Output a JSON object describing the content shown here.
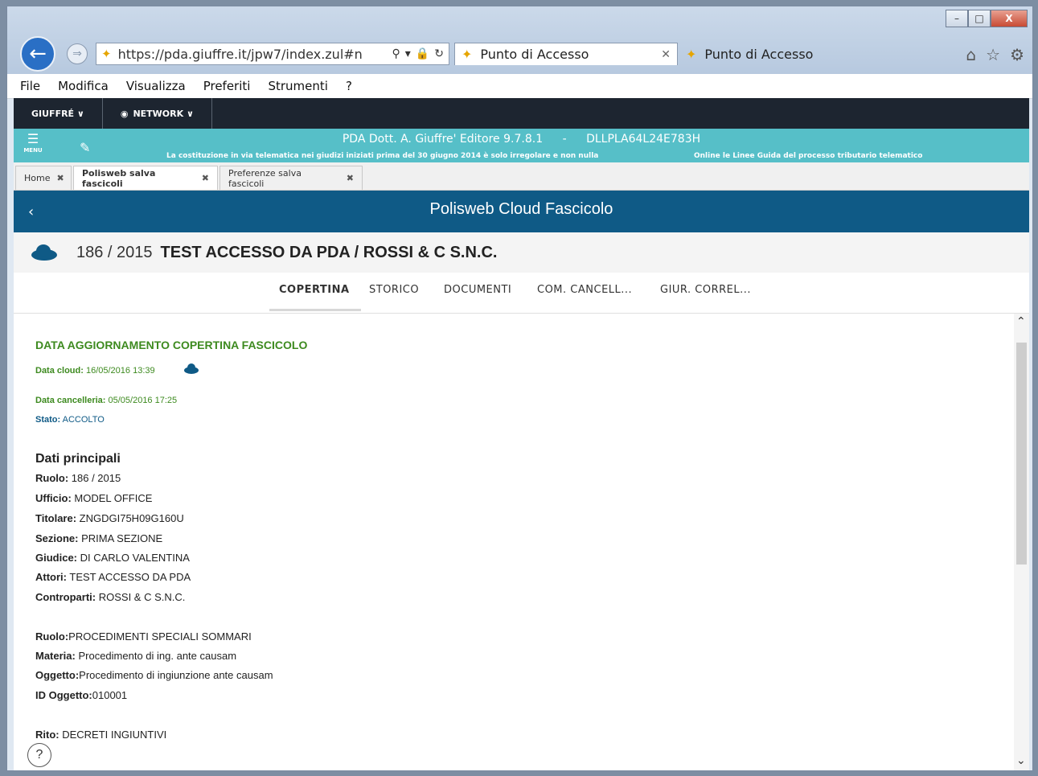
{
  "browser": {
    "url": "https://pda.giuffre.it/jpw7/index.zul#n",
    "tabs": [
      {
        "label": "Punto di Accesso",
        "active": true
      },
      {
        "label": "Punto di Accesso",
        "active": false
      }
    ],
    "menu": [
      "File",
      "Modifica",
      "Visualizza",
      "Preferiti",
      "Strumenti",
      "?"
    ],
    "window_buttons": {
      "min": "–",
      "max": "□",
      "close": "X"
    }
  },
  "navbar": {
    "items": [
      {
        "label": "GIUFFRÉ ∨",
        "icon": "chevron-down-icon"
      },
      {
        "label": "NETWORK ∨",
        "icon": "globe-icon"
      }
    ]
  },
  "banner": {
    "app": "PDA Dott. A. Giuffre' Editore 9.7.8.1",
    "separator": "-",
    "user_code": "DLLPLA64L24E783H",
    "notice_left": "La costituzione in via telematica nei giudizi iniziati prima del 30 giugno 2014 è solo irregolare e non nulla",
    "notice_right": "Online le Linee Guida del processo tributario telematico",
    "menu_label": "MENU"
  },
  "app_tabs": [
    {
      "label": "Home",
      "active": false
    },
    {
      "label": "Polisweb salva fascicoli",
      "active": true
    },
    {
      "label": "Preferenze salva fascicoli",
      "active": false
    }
  ],
  "header": {
    "title": "Polisweb Cloud Fascicolo"
  },
  "case": {
    "number": "186 / 2015",
    "name": "TEST ACCESSO DA PDA / ROSSI & C S.N.C."
  },
  "sections": [
    "COPERTINA",
    "STORICO",
    "DOCUMENTI",
    "COM. CANCELL...",
    "GIUR. CORREL..."
  ],
  "update": {
    "heading": "DATA AGGIORNAMENTO COPERTINA FASCICOLO",
    "cloud_label": "Data cloud:",
    "cloud_value": "16/05/2016 13:39",
    "registry_label": "Data cancelleria:",
    "registry_value": "05/05/2016 17:25",
    "status_label": "Stato:",
    "status_value": "ACCOLTO"
  },
  "main_data": {
    "title": "Dati principali",
    "fields": [
      {
        "label": "Ruolo:",
        "value": " 186 / 2015"
      },
      {
        "label": "Ufficio:",
        "value": " MODEL OFFICE"
      },
      {
        "label": "Titolare:",
        "value": " ZNGDGI75H09G160U"
      },
      {
        "label": "Sezione:",
        "value": " PRIMA SEZIONE"
      },
      {
        "label": "Giudice:",
        "value": " DI CARLO VALENTINA"
      },
      {
        "label": "Attori:",
        "value": " TEST ACCESSO DA PDA"
      },
      {
        "label": "Controparti:",
        "value": " ROSSI & C S.N.C."
      }
    ],
    "fields2": [
      {
        "label": "Ruolo:",
        "value": "PROCEDIMENTI SPECIALI SOMMARI"
      },
      {
        "label": "Materia:",
        "value": " Procedimento di ing. ante causam"
      },
      {
        "label": "Oggetto:",
        "value": "Procedimento di ingiunzione ante causam"
      },
      {
        "label": "ID Oggetto:",
        "value": "010001"
      }
    ],
    "fields3": [
      {
        "label": "Rito:",
        "value": " DECRETI INGIUNTIVI"
      }
    ]
  },
  "help_label": "?",
  "colors": {
    "navbar": "#1d2530",
    "teal": "#56bfc8",
    "header_blue": "#0f5a86",
    "green_text": "#3d8a1f"
  }
}
